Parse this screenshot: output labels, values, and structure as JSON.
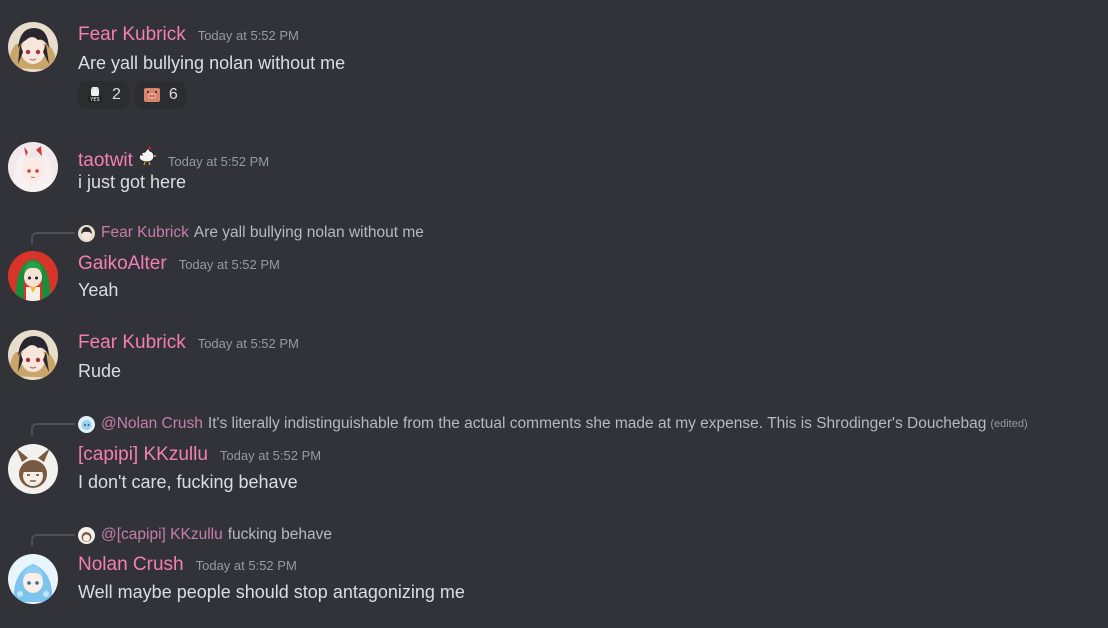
{
  "messages": [
    {
      "username": "Fear Kubrick",
      "timestamp": "Today at 5:52 PM",
      "text": "Are yall bullying nolan without me",
      "avatar_icon": "anime-girl-dark-hair-avatar",
      "reactions": [
        {
          "emoji": "yes-sticker-emoji",
          "count": "2"
        },
        {
          "emoji": "pig-face-emoji",
          "count": "6"
        }
      ]
    },
    {
      "username": "taotwit",
      "name_emoji": "rooster-emoji",
      "timestamp": "Today at 5:52 PM",
      "text": "i just got here",
      "avatar_icon": "anime-girl-white-hair-avatar"
    },
    {
      "reply": {
        "name": "Fear Kubrick",
        "text": "Are yall bullying nolan without me"
      },
      "username": "GaikoAlter",
      "timestamp": "Today at 5:52 PM",
      "text": "Yeah",
      "avatar_icon": "anime-girl-green-hair-avatar"
    },
    {
      "username": "Fear Kubrick",
      "timestamp": "Today at 5:52 PM",
      "text": "Rude",
      "avatar_icon": "anime-girl-dark-hair-avatar"
    },
    {
      "reply": {
        "name": "@Nolan Crush",
        "text": "It's literally indistinguishable from the actual comments she made at my expense. This is Shrodinger's Douchebag",
        "edited": "(edited)"
      },
      "username": "[capipi] KKzullu",
      "timestamp": "Today at 5:52 PM",
      "text": "I don't care, fucking behave",
      "avatar_icon": "bunny-girl-avatar"
    },
    {
      "reply": {
        "name": "@[capipi] KKzullu",
        "text": "fucking behave"
      },
      "username": "Nolan Crush",
      "timestamp": "Today at 5:52 PM",
      "text": "Well maybe people should stop antagonizing me",
      "avatar_icon": "blue-hair-girl-avatar"
    }
  ],
  "colors": {
    "background": "#313338",
    "username": "#f47fb4",
    "timestamp": "#949ba4",
    "text": "#dbdee1",
    "reaction_bg": "#2b2d31"
  }
}
